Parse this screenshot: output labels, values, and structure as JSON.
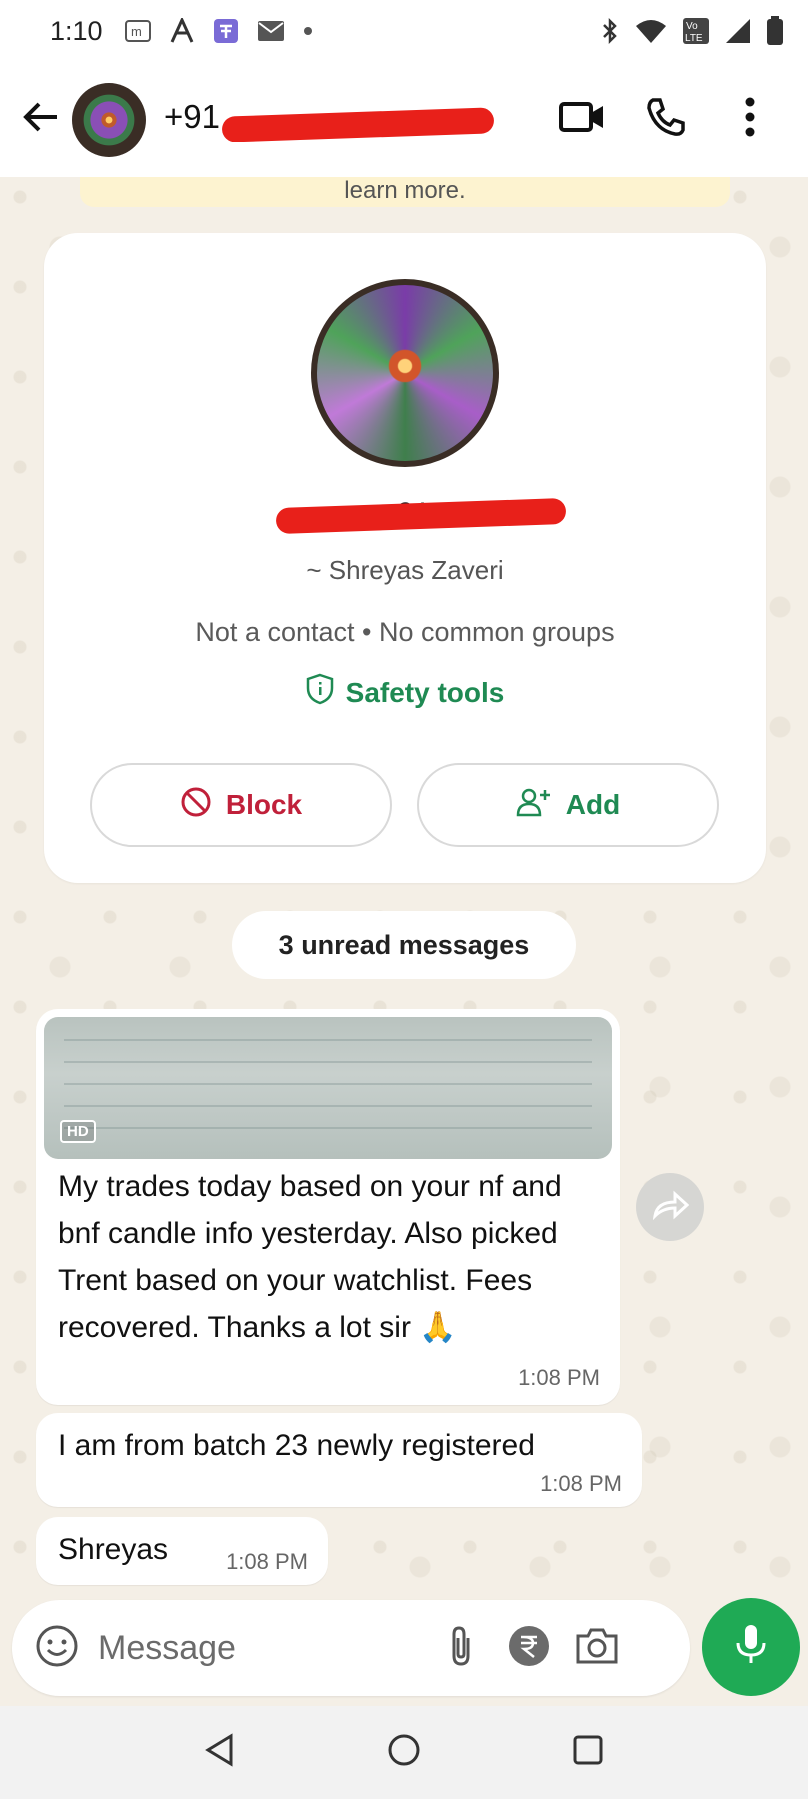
{
  "status_bar": {
    "time": "1:10",
    "icons": [
      "m-app-icon",
      "a-app-icon",
      "t-app-icon",
      "mail-icon",
      "dot-icon",
      "bluetooth-icon",
      "wifi-icon",
      "volte-icon",
      "signal-icon",
      "battery-icon"
    ],
    "volte_label": "Vo LTE"
  },
  "header": {
    "title": "+91 ",
    "icons": [
      "back-arrow-icon",
      "video-call-icon",
      "phone-icon",
      "more-vert-icon"
    ]
  },
  "notice": {
    "text": "learn more."
  },
  "profile_card": {
    "number": "+91",
    "push_name": "~ Shreyas Zaveri",
    "info": "Not a contact • No common groups",
    "safety_tools": "Safety tools",
    "block_label": "Block",
    "add_label": "Add"
  },
  "unread": {
    "text": "3 unread messages"
  },
  "messages": [
    {
      "badge": "HD",
      "text": "My trades today based on your nf and bnf candle info yesterday. Also picked Trent based on your watchlist. Fees recovered. Thanks a lot sir 🙏",
      "time": "1:08 PM"
    },
    {
      "text": "I am from batch 23 newly registered",
      "time": "1:08 PM"
    },
    {
      "text": "Shreyas",
      "time": "1:08 PM"
    }
  ],
  "composer": {
    "placeholder": "Message"
  },
  "colors": {
    "accent_green": "#1faa55",
    "block_red": "#c0203a",
    "safety_green": "#1f8a53",
    "wallpaper": "#f4efe6",
    "redaction": "#e8201a"
  }
}
